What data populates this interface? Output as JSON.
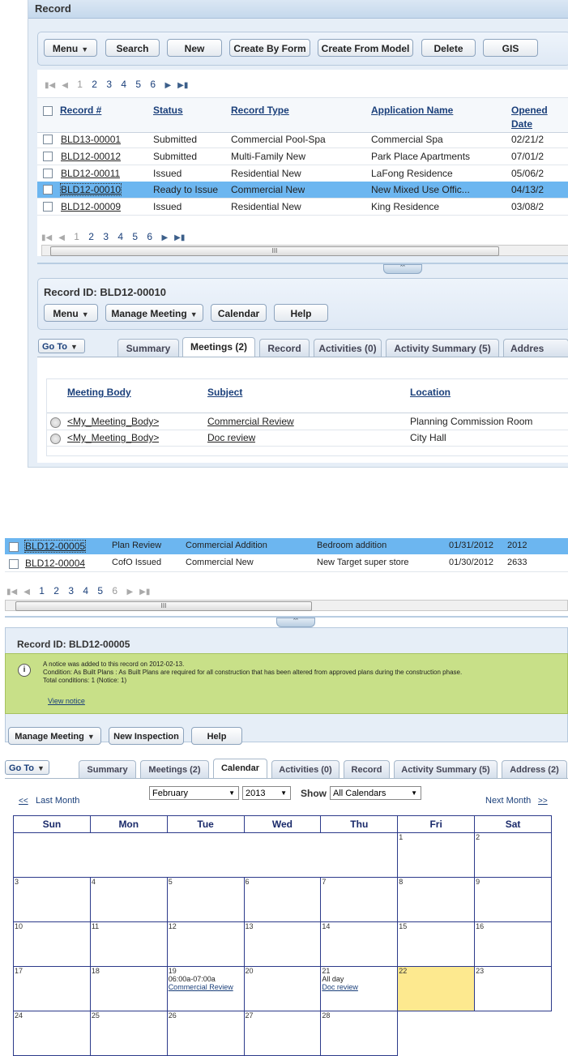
{
  "panel1": {
    "title": "Record",
    "toolbar": [
      "Menu",
      "Search",
      "New",
      "Create By Form",
      "Create From Model",
      "Delete",
      "GIS"
    ],
    "pager": {
      "pages": [
        "1",
        "2",
        "3",
        "4",
        "5",
        "6"
      ]
    },
    "columns": [
      "Record #",
      "Status",
      "Record Type",
      "Application Name",
      "Opened",
      "Date"
    ],
    "rows": [
      {
        "id": "BLD13-00001",
        "status": "Submitted",
        "type": "Commercial Pool-Spa",
        "app": "Commercial Spa",
        "date": "02/21/2"
      },
      {
        "id": "BLD12-00012",
        "status": "Submitted",
        "type": "Multi-Family New",
        "app": "Park Place Apartments",
        "date": "07/01/2"
      },
      {
        "id": "BLD12-00011",
        "status": "Issued",
        "type": "Residential New",
        "app": "LaFong Residence",
        "date": "05/06/2"
      },
      {
        "id": "BLD12-00010",
        "status": "Ready to Issue",
        "type": "Commercial New",
        "app": "New Mixed Use Offic...",
        "date": "04/13/2"
      },
      {
        "id": "BLD12-00009",
        "status": "Issued",
        "type": "Residential New",
        "app": "King Residence",
        "date": "03/08/2"
      }
    ],
    "scroll_grip": "III",
    "record_id": "Record ID: BLD12-00010",
    "detail_buttons": [
      "Menu",
      "Manage Meeting",
      "Calendar",
      "Help"
    ],
    "goto": "Go To",
    "tabs": [
      "Summary",
      "Meetings (2)",
      "Record",
      "Activities (0)",
      "Activity Summary (5)",
      "Addres"
    ],
    "meeting_columns": [
      "Meeting Body",
      "Subject",
      "Location"
    ],
    "meetings": [
      {
        "body": "<My_Meeting_Body>",
        "subject": "Commercial Review",
        "location": "Planning Commission Room"
      },
      {
        "body": "<My_Meeting_Body>",
        "subject": "Doc review",
        "location": "City Hall"
      }
    ]
  },
  "panel2": {
    "rows": [
      {
        "id": "BLD12-00005",
        "status": "Plan Review",
        "type": "Commercial Addition",
        "app": "Bedroom addition",
        "date": "01/31/2012",
        "num": "2012"
      },
      {
        "id": "BLD12-00004",
        "status": "CofO Issued",
        "type": "Commercial New",
        "app": "New Target super store",
        "date": "01/30/2012",
        "num": "2633"
      }
    ],
    "pager": {
      "pages": [
        "1",
        "2",
        "3",
        "4",
        "5",
        "6"
      ]
    },
    "scroll_grip": "III",
    "record_id": "Record ID: BLD12-00005",
    "notice": {
      "line1": "A notice was added to this record on 2012-02-13.",
      "line2": "Condition: As Built Plans : As Built Plans are required for all construction that has been altered from approved plans during the construction phase.",
      "line3": "Total conditions: 1   (Notice: 1)",
      "link": "View notice"
    },
    "detail_buttons": [
      "Manage Meeting",
      "New Inspection",
      "Help"
    ],
    "goto": "Go To",
    "tabs": [
      "Summary",
      "Meetings (2)",
      "Calendar",
      "Activities (0)",
      "Record",
      "Activity Summary (5)",
      "Address (2)"
    ],
    "calendar": {
      "prev_arrow": "<<",
      "prev_label": "Last Month",
      "next_label": "Next Month",
      "next_arrow": ">>",
      "month": "February",
      "year": "2013",
      "show_label": "Show",
      "filter": "All Calendars",
      "weekdays": [
        "Sun",
        "Mon",
        "Tue",
        "Wed",
        "Thu",
        "Fri",
        "Sat"
      ],
      "weeks": [
        [
          "",
          "",
          "",
          "",
          "",
          "1",
          "2"
        ],
        [
          "3",
          "4",
          "5",
          "6",
          "7",
          "8",
          "9"
        ],
        [
          "10",
          "11",
          "12",
          "13",
          "14",
          "15",
          "16"
        ],
        [
          "17",
          "18",
          "19",
          "20",
          "21",
          "22",
          "23"
        ],
        [
          "24",
          "25",
          "26",
          "27",
          "28",
          "",
          ""
        ]
      ],
      "events": {
        "19": {
          "time": "06:00a-07:00a",
          "title": "Commercial Review"
        },
        "21": {
          "time": "All day",
          "title": "Doc review"
        }
      },
      "today": "22"
    }
  },
  "colors": {
    "accent": "#1a3f7a",
    "selected_row": "#6cb6f0",
    "notice": "#c8e088",
    "today": "#fde98f",
    "calendar_border": "#2c3a8a"
  },
  "icons": [
    "info-icon",
    "first-page-icon",
    "prev-page-icon",
    "next-page-icon",
    "last-page-icon",
    "dropdown-arrow-icon",
    "collapse-up-icon"
  ]
}
